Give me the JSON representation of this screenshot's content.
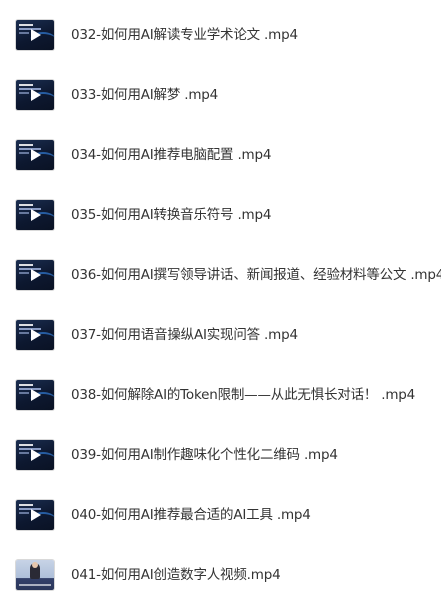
{
  "files": [
    {
      "name": "032-如何用AI解读专业学术论文 .mp4",
      "thumb": "dark"
    },
    {
      "name": "033-如何用AI解梦 .mp4",
      "thumb": "dark"
    },
    {
      "name": "034-如何用AI推荐电脑配置 .mp4",
      "thumb": "dark"
    },
    {
      "name": "035-如何用AI转换音乐符号 .mp4",
      "thumb": "dark"
    },
    {
      "name": "036-如何用AI撰写领导讲话、新闻报道、经验材料等公文 .mp4",
      "thumb": "dark"
    },
    {
      "name": "037-如何用语音操纵AI实现问答 .mp4",
      "thumb": "dark"
    },
    {
      "name": "038-如何解除AI的Token限制——从此无惧长对话！ .mp4",
      "thumb": "dark"
    },
    {
      "name": "039-如何用AI制作趣味化个性化二维码 .mp4",
      "thumb": "dark"
    },
    {
      "name": "040-如何用AI推荐最合适的AI工具 .mp4",
      "thumb": "dark"
    },
    {
      "name": "041-如何用AI创造数字人视频.mp4",
      "thumb": "light"
    }
  ],
  "colors": {
    "text": "#333333",
    "background": "#ffffff",
    "thumb_dark": "#0d1830"
  },
  "icons": {
    "play": "play-icon",
    "thumbnail": "video-thumbnail"
  }
}
